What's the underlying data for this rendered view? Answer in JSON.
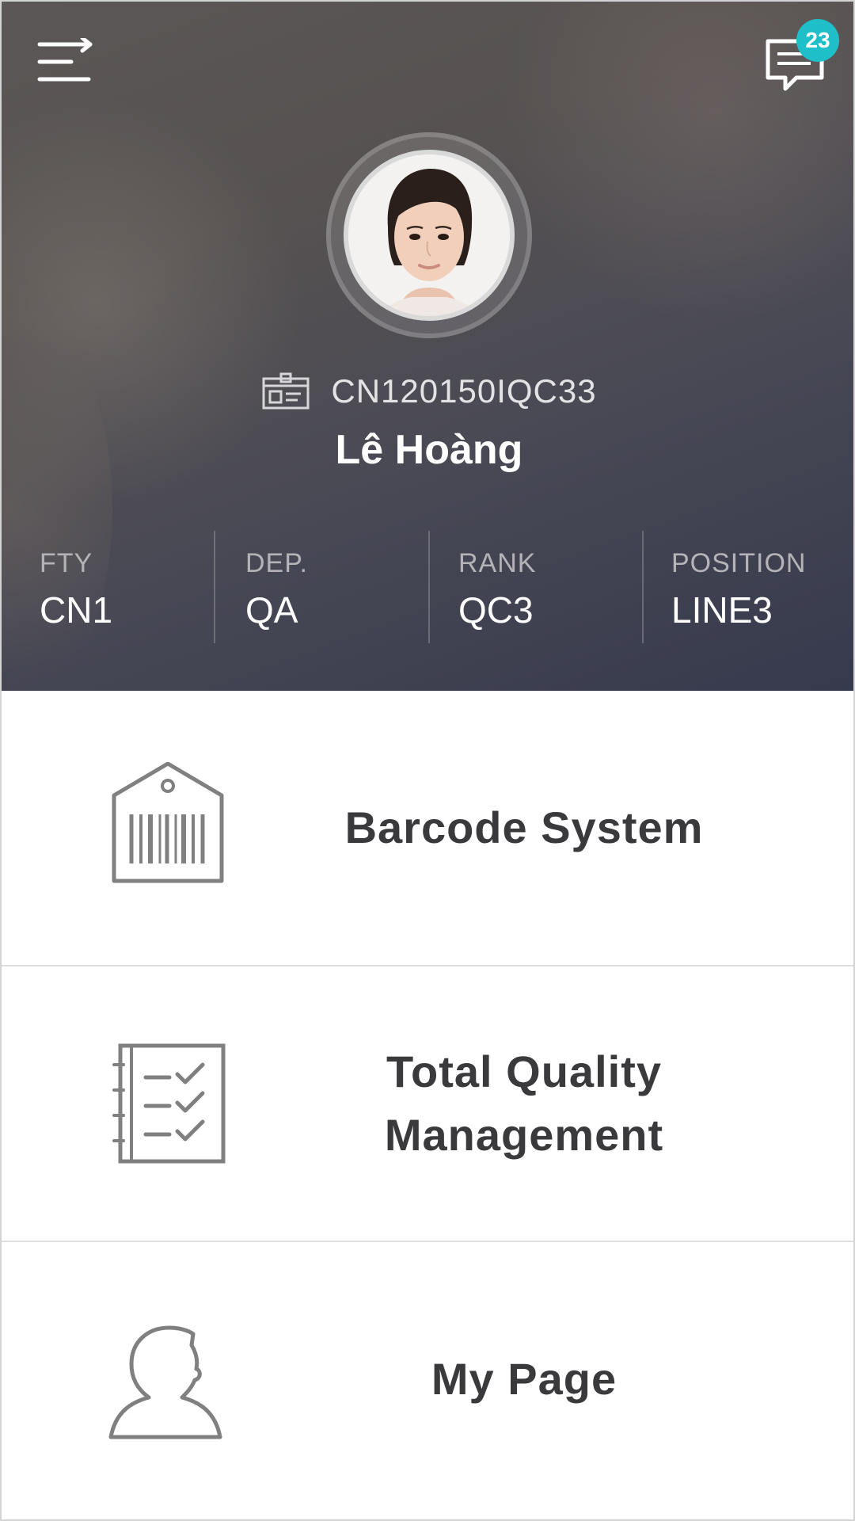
{
  "header": {
    "menu_icon": "menu-arrow-icon",
    "chat_icon": "chat-bubble-icon",
    "notification_count": "23",
    "accent_color": "#1fbfc9"
  },
  "profile": {
    "employee_id": "CN120150IQC33",
    "name": "Lê Hoàng",
    "avatar_icon": "profile-photo"
  },
  "stats": [
    {
      "label": "FTY",
      "value": "CN1"
    },
    {
      "label": "DEP.",
      "value": "QA"
    },
    {
      "label": "RANK",
      "value": "QC3"
    },
    {
      "label": "POSITION",
      "value": "LINE3"
    }
  ],
  "menu": [
    {
      "label": "Barcode System",
      "icon": "barcode-tag-icon"
    },
    {
      "label": "Total Quality Management",
      "icon": "checklist-icon"
    },
    {
      "label": "My Page",
      "icon": "user-icon"
    }
  ]
}
